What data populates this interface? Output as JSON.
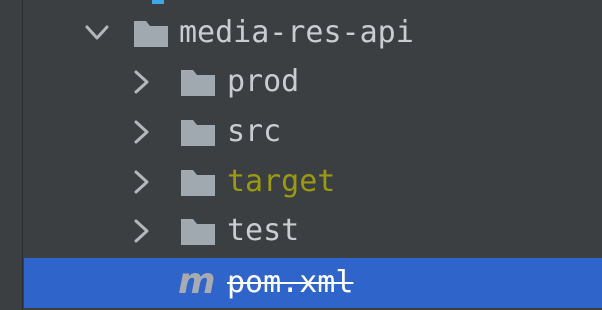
{
  "tree": {
    "items": [
      {
        "label": "media-res-api",
        "state": "expanded",
        "icon": "folder-icon",
        "status": "normal"
      },
      {
        "label": "prod",
        "state": "collapsed",
        "icon": "folder-icon",
        "status": "normal"
      },
      {
        "label": "src",
        "state": "collapsed",
        "icon": "folder-icon",
        "status": "normal"
      },
      {
        "label": "target",
        "state": "collapsed",
        "icon": "folder-icon",
        "status": "excluded"
      },
      {
        "label": "test",
        "state": "collapsed",
        "icon": "folder-icon",
        "status": "normal"
      },
      {
        "label": "pom.xml",
        "icon": "maven-m-icon",
        "icon_glyph": "m",
        "status": "selected"
      }
    ]
  },
  "colors": {
    "background": "#3c3f41",
    "selection": "#2f65ca",
    "folder": "#a0a8b0",
    "excluded_text": "#9a9a10",
    "text": "#c9cdd1",
    "accent": "#3fa6e8"
  }
}
